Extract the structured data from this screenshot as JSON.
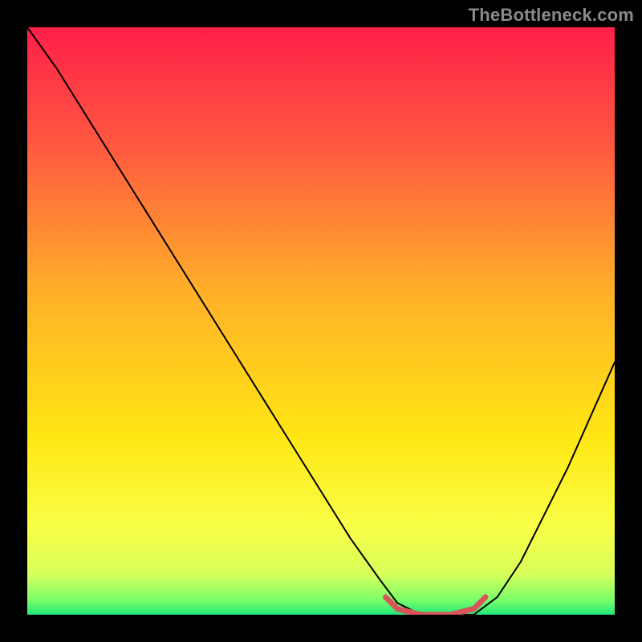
{
  "watermark": "TheBottleneck.com",
  "chart_data": {
    "type": "line",
    "title": "",
    "xlabel": "",
    "ylabel": "",
    "xlim": [
      0,
      100
    ],
    "ylim": [
      0,
      100
    ],
    "gradient_stops": [
      {
        "offset": 0.0,
        "color": "#ff1f49"
      },
      {
        "offset": 0.2,
        "color": "#ff5840"
      },
      {
        "offset": 0.45,
        "color": "#ffb028"
      },
      {
        "offset": 0.7,
        "color": "#ffe714"
      },
      {
        "offset": 0.85,
        "color": "#f9ff47"
      },
      {
        "offset": 0.93,
        "color": "#d8ff5a"
      },
      {
        "offset": 0.975,
        "color": "#7bff6a"
      },
      {
        "offset": 1.0,
        "color": "#20e87a"
      }
    ],
    "series": [
      {
        "name": "bottleneck-curve",
        "color": "#000000",
        "width": 2,
        "x": [
          0,
          5,
          10,
          15,
          20,
          25,
          30,
          35,
          40,
          45,
          50,
          55,
          60,
          63,
          67,
          72,
          76,
          80,
          84,
          88,
          92,
          96,
          100
        ],
        "y": [
          100,
          93,
          85,
          77,
          69,
          61,
          53,
          45,
          37,
          29,
          21,
          13,
          6,
          2,
          0,
          0,
          0,
          3,
          9,
          17,
          25,
          34,
          43
        ]
      },
      {
        "name": "optimal-range",
        "color": "#d9545b",
        "width": 7,
        "x": [
          61,
          63,
          67,
          72,
          76,
          78
        ],
        "y": [
          3,
          1,
          0,
          0,
          1,
          3
        ]
      }
    ]
  }
}
